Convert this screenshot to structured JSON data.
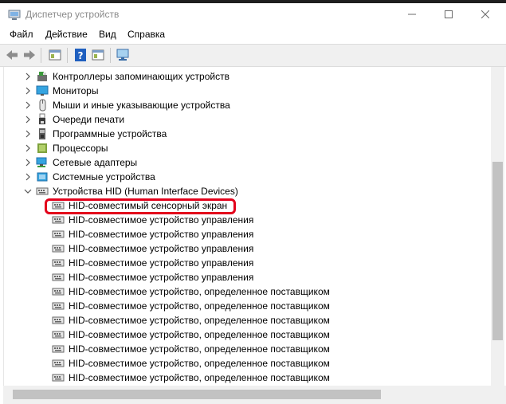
{
  "window": {
    "title": "Диспетчер устройств"
  },
  "menu": [
    "Файл",
    "Действие",
    "Вид",
    "Справка"
  ],
  "tree": {
    "categories": [
      {
        "label": "Контроллеры запоминающих устройств",
        "icon": "storage-controller-icon",
        "expanded": false
      },
      {
        "label": "Мониторы",
        "icon": "monitor-icon",
        "expanded": false
      },
      {
        "label": "Мыши и иные указывающие устройства",
        "icon": "mouse-icon",
        "expanded": false
      },
      {
        "label": "Очереди печати",
        "icon": "printer-icon",
        "expanded": false
      },
      {
        "label": "Программные устройства",
        "icon": "software-device-icon",
        "expanded": false
      },
      {
        "label": "Процессоры",
        "icon": "processor-icon",
        "expanded": false
      },
      {
        "label": "Сетевые адаптеры",
        "icon": "network-adapter-icon",
        "expanded": false
      },
      {
        "label": "Системные устройства",
        "icon": "system-device-icon",
        "expanded": false
      },
      {
        "label": "Устройства HID (Human Interface Devices)",
        "icon": "hid-icon",
        "expanded": true
      }
    ],
    "hid_children": [
      "HID-совместимый сенсорный экран",
      "HID-совместимое устройство управления",
      "HID-совместимое устройство управления",
      "HID-совместимое устройство управления",
      "HID-совместимое устройство управления",
      "HID-совместимое устройство управления",
      "HID-совместимое устройство, определенное поставщиком",
      "HID-совместимое устройство, определенное поставщиком",
      "HID-совместимое устройство, определенное поставщиком",
      "HID-совместимое устройство, определенное поставщиком",
      "HID-совместимое устройство, определенное поставщиком",
      "HID-совместимое устройство, определенное поставщиком",
      "HID-совместимое устройство, определенное поставщиком"
    ],
    "highlighted_child": 0
  },
  "colors": {
    "highlight": "#e3001b",
    "scroll_thumb": "#c2c2c2"
  }
}
